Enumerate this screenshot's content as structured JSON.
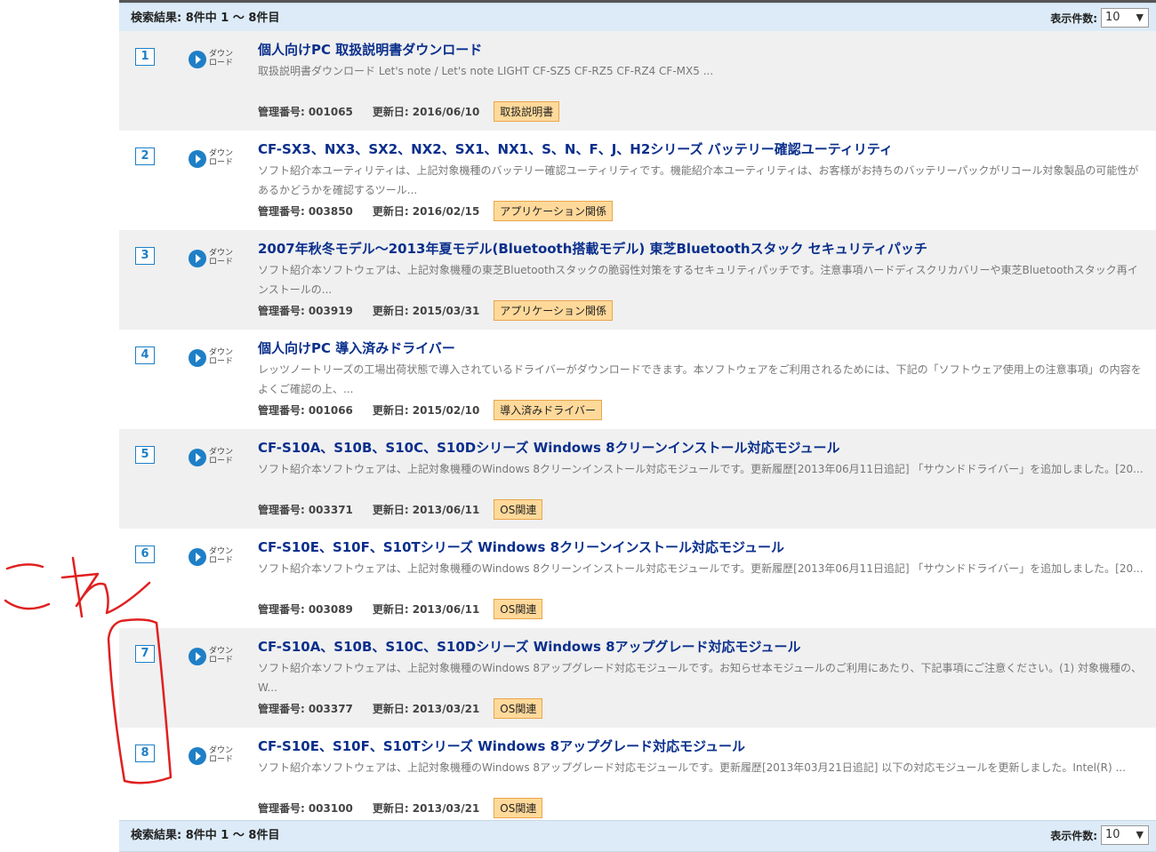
{
  "summary_top": "検索結果: 8件中 1 ～ 8件目",
  "summary_bottom": "検索結果: 8件中 1 ～ 8件目",
  "perpage": {
    "label": "表示件数:",
    "value": "10",
    "arrow": "▼"
  },
  "download_label": "ダウンロード",
  "labels": {
    "kanri": "管理番号:",
    "koushin": "更新日:"
  },
  "results": [
    {
      "num": "1",
      "title": "個人向けPC 取扱説明書ダウンロード",
      "desc": "取扱説明書ダウンロード Let's note / Let's note LIGHT CF-SZ5 CF-RZ5 CF-RZ4 CF-MX5 ...",
      "id": "001065",
      "date": "2016/06/10",
      "tag": "取扱説明書"
    },
    {
      "num": "2",
      "title": "CF-SX3、NX3、SX2、NX2、SX1、NX1、S、N、F、J、H2シリーズ バッテリー確認ユーティリティ",
      "desc": "ソフト紹介本ユーティリティは、上記対象機種のバッテリー確認ユーティリティです。機能紹介本ユーティリティは、お客様がお持ちのバッテリーパックがリコール対象製品の可能性があるかどうかを確認するツール...",
      "id": "003850",
      "date": "2016/02/15",
      "tag": "アプリケーション関係"
    },
    {
      "num": "3",
      "title": "2007年秋冬モデル～2013年夏モデル(Bluetooth搭載モデル) 東芝Bluetoothスタック セキュリティパッチ",
      "desc": "ソフト紹介本ソフトウェアは、上記対象機種の東芝Bluetoothスタックの脆弱性対策をするセキュリティパッチです。注意事項ハードディスクリカバリーや東芝Bluetoothスタック再インストールの...",
      "id": "003919",
      "date": "2015/03/31",
      "tag": "アプリケーション関係"
    },
    {
      "num": "4",
      "title": "個人向けPC 導入済みドライバー",
      "desc": "レッツノートリーズの工場出荷状態で導入されているドライバーがダウンロードできます。本ソフトウェアをご利用されるためには、下記の「ソフトウェア使用上の注意事項」の内容をよくご確認の上、...",
      "id": "001066",
      "date": "2015/02/10",
      "tag": "導入済みドライバー"
    },
    {
      "num": "5",
      "title": "CF-S10A、S10B、S10C、S10Dシリーズ Windows 8クリーンインストール対応モジュール",
      "desc": "ソフト紹介本ソフトウェアは、上記対象機種のWindows 8クリーンインストール対応モジュールです。更新履歴[2013年06月11日追記] 「サウンドドライバー」を追加しました。[20...",
      "id": "003371",
      "date": "2013/06/11",
      "tag": "OS関連"
    },
    {
      "num": "6",
      "title": "CF-S10E、S10F、S10Tシリーズ Windows 8クリーンインストール対応モジュール",
      "desc": "ソフト紹介本ソフトウェアは、上記対象機種のWindows 8クリーンインストール対応モジュールです。更新履歴[2013年06月11日追記] 「サウンドドライバー」を追加しました。[20...",
      "id": "003089",
      "date": "2013/06/11",
      "tag": "OS関連"
    },
    {
      "num": "7",
      "title": "CF-S10A、S10B、S10C、S10Dシリーズ Windows 8アップグレード対応モジュール",
      "desc": "ソフト紹介本ソフトウェアは、上記対象機種のWindows 8アップグレード対応モジュールです。お知らせ本モジュールのご利用にあたり、下記事項にご注意ください。(1) 対象機種の、W...",
      "id": "003377",
      "date": "2013/03/21",
      "tag": "OS関連"
    },
    {
      "num": "8",
      "title": "CF-S10E、S10F、S10Tシリーズ Windows 8アップグレード対応モジュール",
      "desc": "ソフト紹介本ソフトウェアは、上記対象機種のWindows 8アップグレード対応モジュールです。更新履歴[2013年03月21日追記] 以下の対応モジュールを更新しました。Intel(R) ...",
      "id": "003100",
      "date": "2013/03/21",
      "tag": "OS関連"
    }
  ],
  "annotation": {
    "text": "これ",
    "color": "#e02020"
  }
}
